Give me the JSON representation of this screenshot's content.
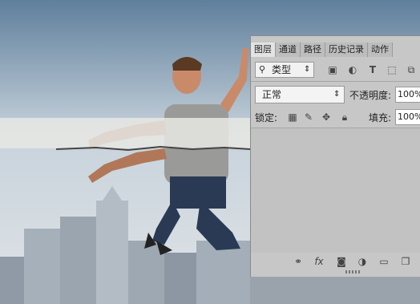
{
  "tabs": [
    "图层",
    "通道",
    "路径",
    "历史记录",
    "动作"
  ],
  "filter": {
    "label": "类型",
    "arrow": "⇕"
  },
  "blend_mode": {
    "value": "正常",
    "arrow": "⇕"
  },
  "opacity": {
    "label": "不透明度:",
    "value": "100%"
  },
  "lock": {
    "label": "锁定:"
  },
  "fill": {
    "label": "填充:",
    "value": "100%"
  },
  "colors": {
    "panel_bg": "#c7c7c7",
    "tab_active": "#e3e3e3",
    "sky_top": "#5f7f9c",
    "shirt": "#9a9a98",
    "jeans": "#2a3a55"
  },
  "icons": [
    "image-filter-icon",
    "adjustment-filter-icon",
    "type-filter-icon",
    "shape-filter-icon",
    "smart-object-filter-icon",
    "link-icon",
    "fx-icon",
    "mask-icon",
    "adjustment-layer-icon",
    "folder-icon",
    "new-layer-icon"
  ]
}
